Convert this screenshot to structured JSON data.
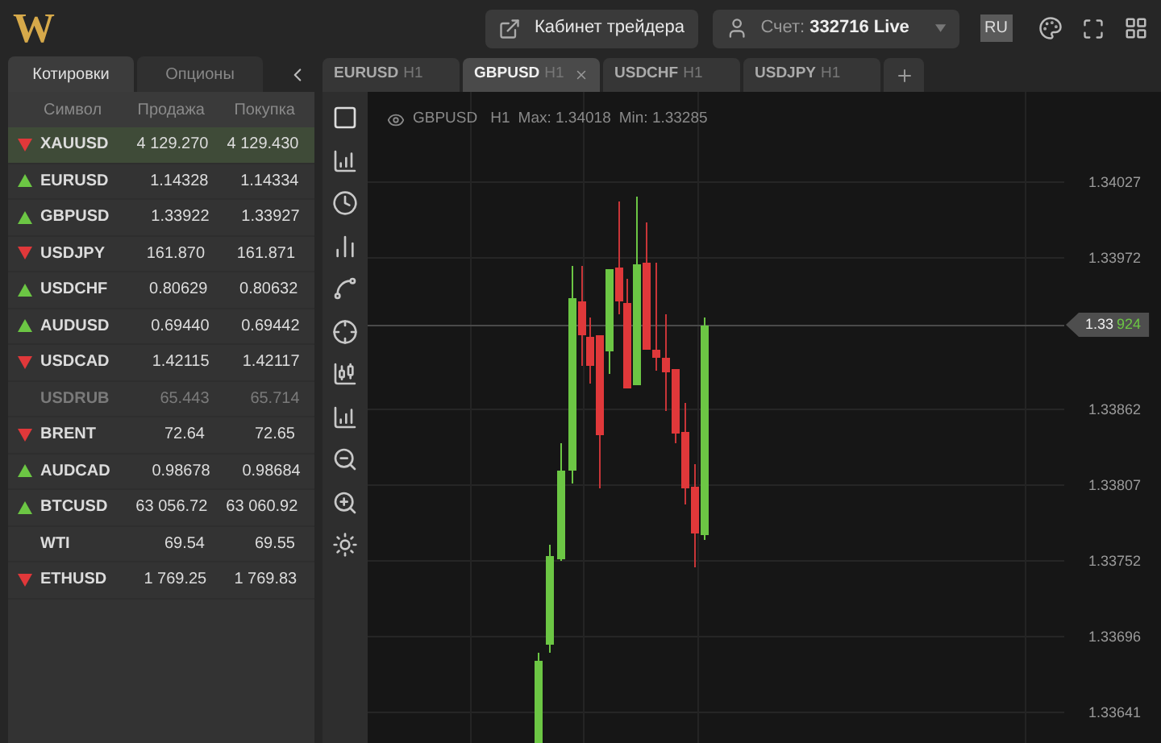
{
  "logo": {
    "letter": "W"
  },
  "top_bar": {
    "cabinet_button": "Кабинет трейдера",
    "account": {
      "label": "Счет:",
      "number": "332716 Live"
    },
    "language": "RU"
  },
  "quotes_panel": {
    "tabs": [
      {
        "label": "Котировки",
        "selected": true
      },
      {
        "label": "Опционы",
        "selected": false
      }
    ],
    "columns": [
      "Символ",
      "Продажа",
      "Покупка"
    ],
    "rows": [
      {
        "symbol": "XAUUSD",
        "kind": "down",
        "sell": "4 129.270",
        "buy": "4 129.430",
        "selected": true,
        "disabled": false
      },
      {
        "symbol": "EURUSD",
        "kind": "up",
        "sell": "1.14328",
        "buy": "1.14334",
        "selected": false,
        "disabled": false
      },
      {
        "symbol": "GBPUSD",
        "kind": "up",
        "sell": "1.33922",
        "buy": "1.33927",
        "selected": false,
        "disabled": false
      },
      {
        "symbol": "USDJPY",
        "kind": "down",
        "sell": "161.870",
        "buy": "161.871",
        "selected": false,
        "disabled": false
      },
      {
        "symbol": "USDCHF",
        "kind": "up",
        "sell": "0.80629",
        "buy": "0.80632",
        "selected": false,
        "disabled": false
      },
      {
        "symbol": "AUDUSD",
        "kind": "up",
        "sell": "0.69440",
        "buy": "0.69442",
        "selected": false,
        "disabled": false
      },
      {
        "symbol": "USDCAD",
        "kind": "down",
        "sell": "1.42115",
        "buy": "1.42117",
        "selected": false,
        "disabled": false
      },
      {
        "symbol": "USDRUB",
        "kind": "none",
        "sell": "65.443",
        "buy": "65.714",
        "selected": false,
        "disabled": true
      },
      {
        "symbol": "BRENT",
        "kind": "down",
        "sell": "72.64",
        "buy": "72.65",
        "selected": false,
        "disabled": false
      },
      {
        "symbol": "AUDCAD",
        "kind": "up",
        "sell": "0.98678",
        "buy": "0.98684",
        "selected": false,
        "disabled": false
      },
      {
        "symbol": "BTCUSD",
        "kind": "up",
        "sell": "63 056.72",
        "buy": "63 060.92",
        "selected": false,
        "disabled": false
      },
      {
        "symbol": "WTI",
        "kind": "none",
        "sell": "69.54",
        "buy": "69.55",
        "selected": false,
        "disabled": false
      },
      {
        "symbol": "ETHUSD",
        "kind": "down",
        "sell": "1 769.25",
        "buy": "1 769.83",
        "selected": false,
        "disabled": false
      }
    ]
  },
  "chart_tabs": [
    {
      "symbol": "EURUSD",
      "timeframe": "H1",
      "selected": false
    },
    {
      "symbol": "GBPUSD",
      "timeframe": "H1",
      "selected": true
    },
    {
      "symbol": "USDCHF",
      "timeframe": "H1",
      "selected": false
    },
    {
      "symbol": "USDJPY",
      "timeframe": "H1",
      "selected": false
    }
  ],
  "chart": {
    "symbol": "GBPUSD",
    "timeframe": "H1",
    "max": "Max: 1.34018",
    "min": "Min: 1.33285",
    "price_labels": [
      "1.34027",
      "1.33972",
      "1.33862",
      "1.33807",
      "1.33752",
      "1.33696",
      "1.33641"
    ],
    "current_price": {
      "main": "1.33",
      "tail": "924"
    }
  }
}
